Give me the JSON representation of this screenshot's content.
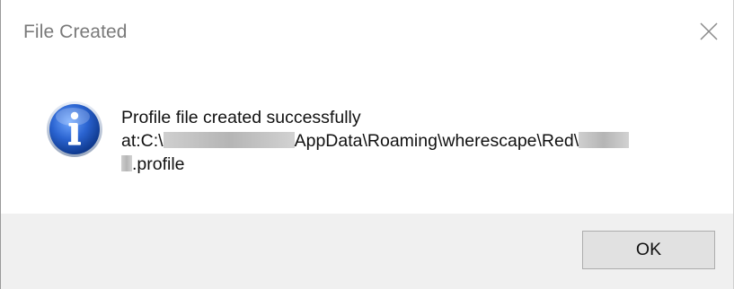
{
  "dialog": {
    "title": "File Created",
    "close_glyph": "✕",
    "icon": "info-icon",
    "message": {
      "line1": "Profile file created successfully",
      "line2_prefix": "at:C:\\",
      "line2_path": "AppData\\Roaming\\wherescape\\Red\\",
      "line3_suffix": ".profile"
    },
    "ok_label": "OK"
  },
  "colors": {
    "title_text": "#7a7a7a",
    "footer_bg": "#f0f0f0",
    "button_bg": "#e1e1e1",
    "button_border": "#adadad",
    "icon_blue": "#1f56b8"
  }
}
